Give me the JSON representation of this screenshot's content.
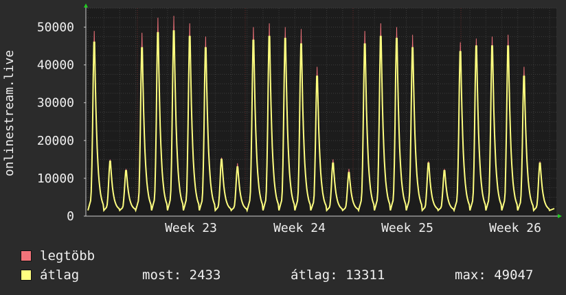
{
  "chart_data": {
    "type": "area",
    "ylabel": "onlinestream.live",
    "ylim": [
      0,
      55000
    ],
    "yticks": [
      0,
      10000,
      20000,
      30000,
      40000,
      50000
    ],
    "ytick_labels": [
      "0",
      "10000",
      "20000",
      "30000",
      "40000",
      "50000"
    ],
    "x_ticks": [
      "Week 23",
      "Week 24",
      "Week 25",
      "Week 26"
    ],
    "grid": true,
    "legend_position": "bottom-left",
    "series": [
      {
        "name": "legtöbb",
        "color": "#f2737a",
        "daily_peaks": [
          49000,
          15000,
          12500,
          48500,
          52500,
          53000,
          51000,
          47500,
          15500,
          14000,
          50000,
          51000,
          50000,
          49500,
          39500,
          15000,
          12500,
          49000,
          51000,
          50000,
          48000,
          14500,
          12500,
          46000,
          47000,
          47500,
          48000,
          39500,
          14500
        ]
      },
      {
        "name": "átlag",
        "color": "#ffff80",
        "daily_peaks": [
          46000,
          14500,
          12000,
          44500,
          48500,
          49000,
          47500,
          44500,
          15000,
          13000,
          46500,
          47500,
          47000,
          45500,
          37000,
          14000,
          11500,
          45500,
          47500,
          47000,
          44500,
          14000,
          12000,
          43500,
          45000,
          45000,
          45000,
          37000,
          14000
        ]
      }
    ]
  },
  "legend": {
    "max_label": "legtöbb",
    "avg_label": "átlag"
  },
  "stats": {
    "now": "most: 2433",
    "avg": "átlag: 13311",
    "max": "max: 49047"
  },
  "colors": {
    "background": "#2b2b2b",
    "plot_background": "#1c1c1c",
    "grid": "#3d3d3d",
    "vgrid_major": "#6a2a2a",
    "max_series": "#f2737a",
    "avg_series": "#ffff80",
    "axis_arrow": "#22cc22"
  }
}
